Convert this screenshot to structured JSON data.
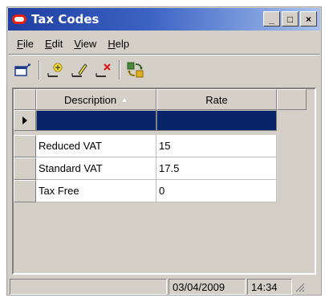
{
  "window": {
    "title": "Tax Codes",
    "min_glyph": "_",
    "max_glyph": "□",
    "close_glyph": "×"
  },
  "menu": [
    {
      "label": "File",
      "mnemonic": "F",
      "rest": "ile"
    },
    {
      "label": "Edit",
      "mnemonic": "E",
      "rest": "dit"
    },
    {
      "label": "View",
      "mnemonic": "V",
      "rest": "iew"
    },
    {
      "label": "Help",
      "mnemonic": "H",
      "rest": "elp"
    }
  ],
  "toolbar": {
    "icons": [
      "window-icon",
      "add-record-icon",
      "edit-record-icon",
      "delete-record-icon",
      "refresh-icon"
    ]
  },
  "grid": {
    "columns": [
      "Description",
      "Rate"
    ],
    "sort_indicator": "▲",
    "rows": [
      {
        "description": "Reduced VAT",
        "rate": "15"
      },
      {
        "description": "Standard VAT",
        "rate": "17.5"
      },
      {
        "description": "Tax Free",
        "rate": "0"
      }
    ]
  },
  "status": {
    "date": "03/04/2009",
    "time": "14:34"
  },
  "colors": {
    "title_start": "#1d3ea0",
    "title_end": "#a6c1ee",
    "selection": "#0a246a",
    "logo_red": "#e8210f"
  }
}
